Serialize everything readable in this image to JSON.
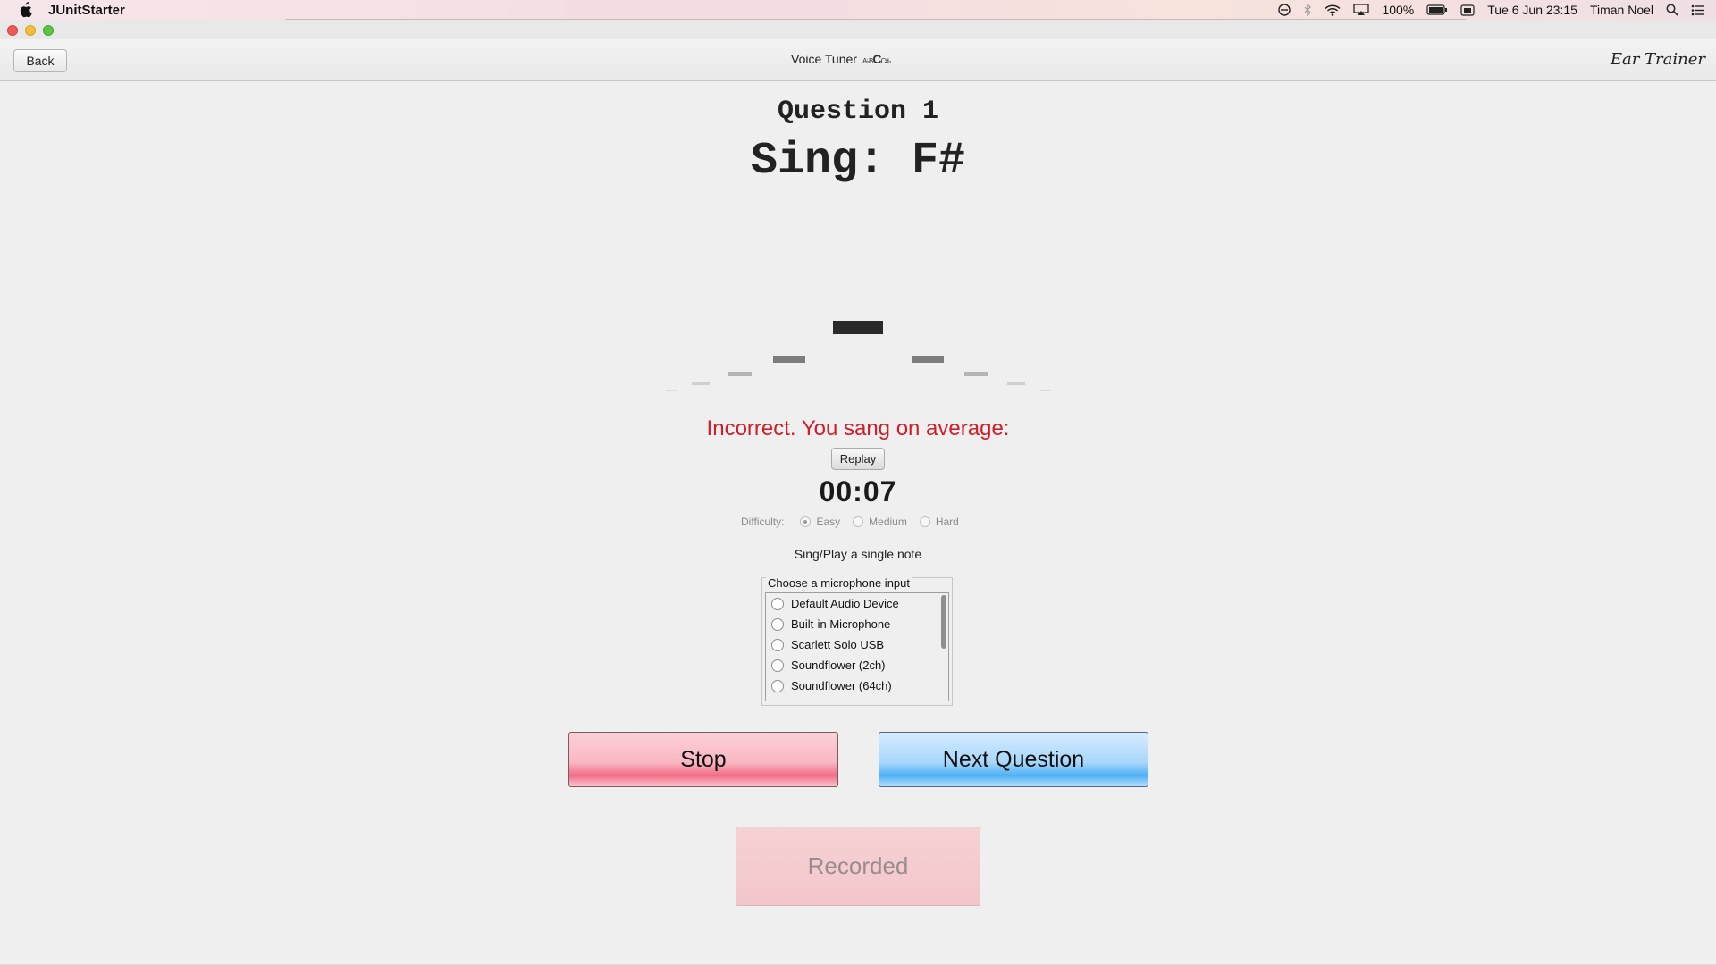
{
  "menubar": {
    "app_name": "JUnitStarter",
    "battery": "100%",
    "datetime": "Tue 6 Jun  23:15",
    "user": "Timan Noel"
  },
  "toolbar": {
    "back_label": "Back",
    "title": "Voice Tuner",
    "title_logo_small": "A♭B",
    "title_logo_big": "C",
    "title_logo_end": "C#♭",
    "brand": "Ear Trainer"
  },
  "question": {
    "number_label": "Question 1",
    "prompt": "Sing:  F#"
  },
  "result": {
    "text": "Incorrect. You sang on average:",
    "replay_label": "Replay",
    "timer": "00:07"
  },
  "difficulty": {
    "label": "Difficulty:",
    "options": [
      "Easy",
      "Medium",
      "Hard"
    ],
    "selected": "Easy"
  },
  "hint": "Sing/Play a single note",
  "microphone": {
    "legend": "Choose a microphone input",
    "devices": [
      "Default Audio Device",
      "Built-in Microphone",
      "Scarlett Solo USB",
      "Soundflower (2ch)",
      "Soundflower (64ch)"
    ]
  },
  "buttons": {
    "stop": "Stop",
    "next": "Next Question",
    "recorded": "Recorded"
  },
  "colors": {
    "incorrect": "#cf1e2a",
    "stop": "#f06d85",
    "next": "#4eb0f4"
  }
}
